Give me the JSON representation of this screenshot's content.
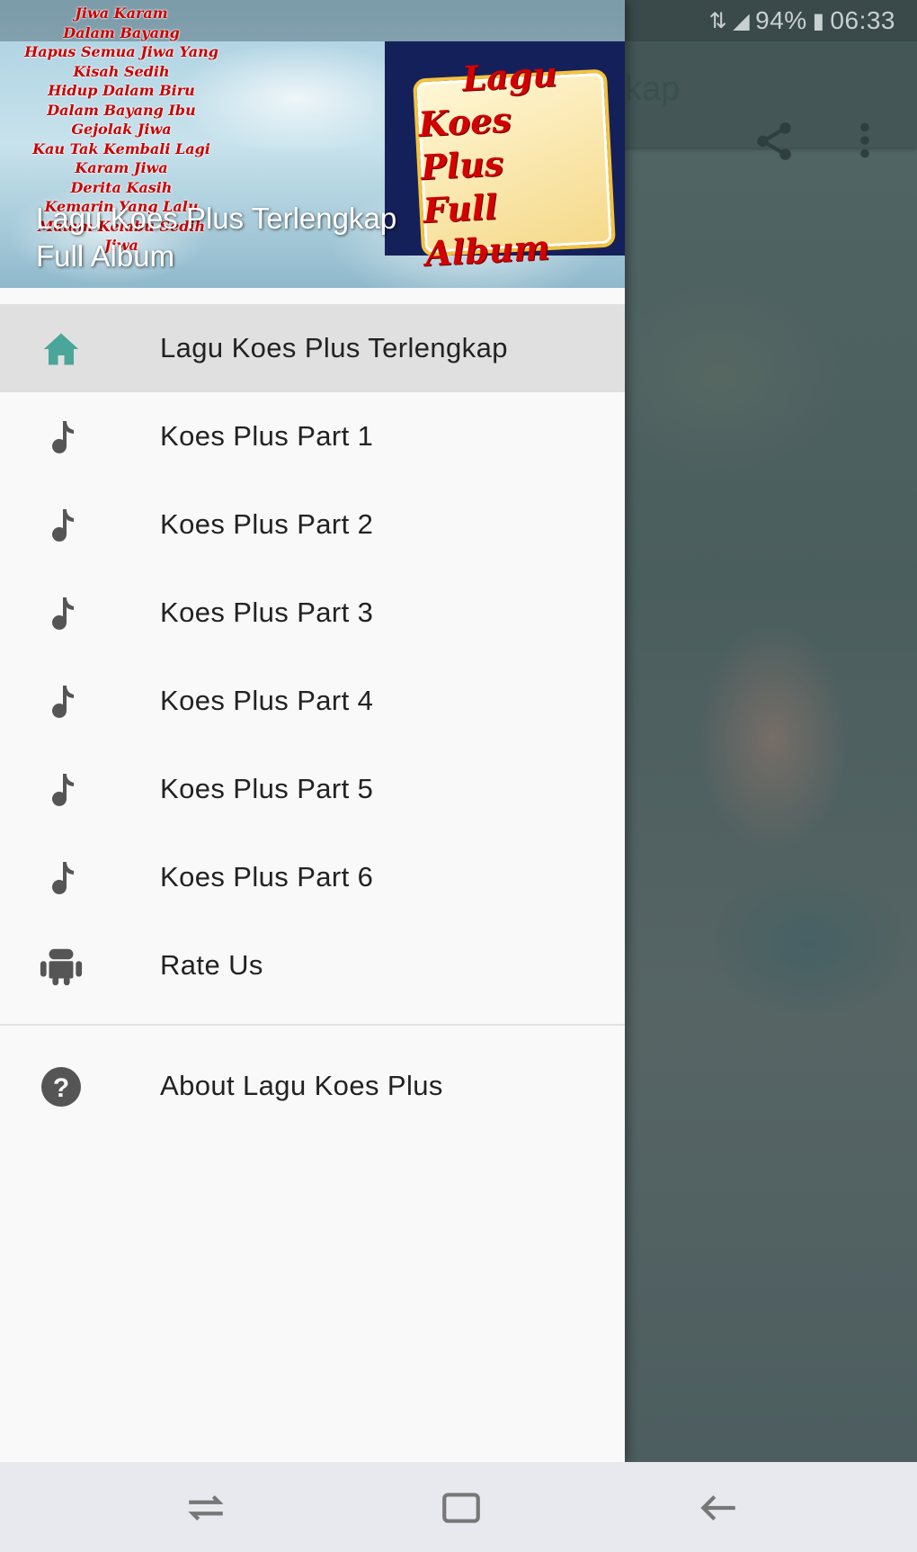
{
  "status_bar": {
    "battery": "94%",
    "time": "06:33"
  },
  "toolbar": {
    "title_fragment": "kap",
    "share_icon": "share-icon",
    "more_icon": "more-vert-icon"
  },
  "drawer": {
    "header": {
      "title_line1": "Lagu Koes Plus Terlengkap",
      "title_line2": "Full Album",
      "album_art": {
        "line1": "Lagu",
        "line2": "Koes Plus",
        "line3": "Full Album"
      }
    },
    "items": [
      {
        "label": "Lagu Koes Plus Terlengkap",
        "icon": "home-icon",
        "selected": true
      },
      {
        "label": "Koes Plus Part 1",
        "icon": "music-note-icon"
      },
      {
        "label": "Koes Plus Part 2",
        "icon": "music-note-icon"
      },
      {
        "label": "Koes Plus Part 3",
        "icon": "music-note-icon"
      },
      {
        "label": "Koes Plus Part 4",
        "icon": "music-note-icon"
      },
      {
        "label": "Koes Plus Part 5",
        "icon": "music-note-icon"
      },
      {
        "label": "Koes Plus Part 6",
        "icon": "music-note-icon"
      },
      {
        "label": "Rate Us",
        "icon": "android-icon"
      }
    ],
    "about": {
      "label": "About Lagu Koes Plus",
      "icon": "help-icon"
    }
  },
  "nav_bar": {
    "recents_icon": "recents-icon",
    "home_icon": "home-button-icon",
    "back_icon": "back-icon"
  },
  "colors": {
    "accent": "#4aa59a",
    "scrim": "#4b5e5e",
    "drawer_bg": "#f9f9f9",
    "selected_bg": "#e0e0e0"
  }
}
